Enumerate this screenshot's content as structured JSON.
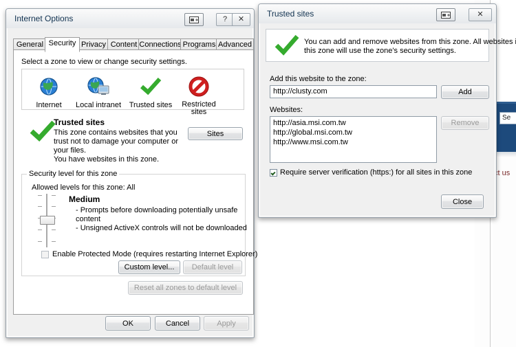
{
  "background_page": {
    "search_value": "Se",
    "link_text": "ct us",
    "navbar_color": "#1d4a7c"
  },
  "internet_options": {
    "title": "Internet Options",
    "titlebar_buttons": [
      {
        "name": "restore-icon",
        "glyph": "❐"
      },
      {
        "name": "help-icon",
        "glyph": "?"
      },
      {
        "name": "close-icon",
        "glyph": "✕"
      }
    ],
    "tabs": [
      {
        "label": "General",
        "active": false
      },
      {
        "label": "Security",
        "active": true
      },
      {
        "label": "Privacy",
        "active": false
      },
      {
        "label": "Content",
        "active": false
      },
      {
        "label": "Connections",
        "active": false
      },
      {
        "label": "Programs",
        "active": false
      },
      {
        "label": "Advanced",
        "active": false
      }
    ],
    "zone_prompt": "Select a zone to view or change security settings.",
    "zones": [
      {
        "label": "Internet",
        "icon": "globe-icon"
      },
      {
        "label": "Local intranet",
        "icon": "globe-monitor-icon"
      },
      {
        "label": "Trusted sites",
        "icon": "green-check-icon"
      },
      {
        "label": "Restricted sites",
        "icon": "red-prohibition-icon"
      }
    ],
    "selected_zone": {
      "name": "Trusted sites",
      "icon": "green-check-icon",
      "description_line1": "This zone contains websites that you",
      "description_line2": "trust not to damage your computer or",
      "description_line3": "your files.",
      "description_line4": "You have websites in this zone."
    },
    "sites_button": "Sites",
    "security_level": {
      "group_label": "Security level for this zone",
      "allowed_levels": "Allowed levels for this zone: All",
      "level_name": "Medium",
      "bullet1_line1": "- Prompts before downloading potentially unsafe",
      "bullet1_line2": "content",
      "bullet2": "- Unsigned ActiveX controls will not be downloaded",
      "slider_position_percent": 41
    },
    "protected_mode": {
      "label": "Enable Protected Mode (requires restarting Internet Explorer)",
      "checked": false
    },
    "custom_level_button": "Custom level...",
    "default_level_button": "Default level",
    "default_level_disabled": true,
    "reset_all_button": "Reset all zones to default level",
    "reset_all_disabled": true,
    "ok_button": "OK",
    "cancel_button": "Cancel",
    "apply_button": "Apply",
    "apply_disabled": true
  },
  "trusted_sites": {
    "title": "Trusted sites",
    "titlebar_buttons": [
      {
        "name": "restore-icon",
        "glyph": "❐"
      },
      {
        "name": "close-icon",
        "glyph": "✕"
      }
    ],
    "banner_icon": "green-check-icon",
    "banner_line1": "You can add and remove websites from this zone. All websites in",
    "banner_line2": "this zone will use the zone's security settings.",
    "add_label": "Add this website to the zone:",
    "add_input_value": "http://clusty.com",
    "add_button": "Add",
    "websites_label": "Websites:",
    "websites": [
      "http://asia.msi.com.tw",
      "http://global.msi.com.tw",
      "http://www.msi.com.tw"
    ],
    "remove_button": "Remove",
    "remove_disabled": true,
    "require_verification": {
      "label": "Require server verification (https:) for all sites in this zone",
      "checked": true
    },
    "close_button": "Close"
  }
}
